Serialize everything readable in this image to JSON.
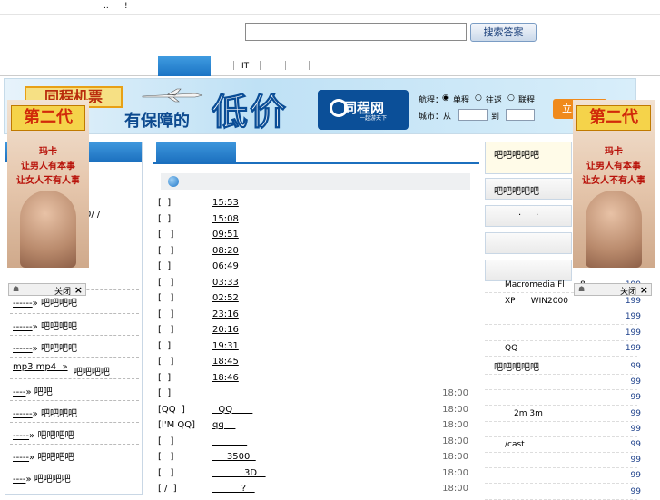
{
  "topbar": {
    "sep": "..",
    "mark": "!"
  },
  "search": {
    "placeholder": "",
    "button": "搜索答案"
  },
  "nav": {
    "tab_it": "IT"
  },
  "banner": {
    "brand": "同程机票",
    "slogan": "有保障的",
    "big": "低价",
    "logo": "同程网",
    "logo_sub": "一起游天下",
    "route_label": "航程：",
    "opt_single": "单程",
    "opt_round": "往返",
    "opt_multi": "联程",
    "city_label": "城市：从",
    "to_label": "到",
    "go": "立即"
  },
  "float_ad": {
    "title": "第二代",
    "sub1": "玛卡",
    "sub2": "让男人有本事",
    "sub3": "让女人不有人事",
    "close": "关闭",
    "x": "×"
  },
  "left": {
    "items": [
      {
        "dash": "‐‐‐‐‐‐‐",
        "text": "",
        "suffix": ""
      },
      {
        "dash": "",
        "text": "0/ /  ",
        "suffix": ""
      },
      {
        "dash": "‐‐‐‐‐‐",
        "text": "»",
        "suffix": "吧吧吧吧"
      },
      {
        "dash": "‐‐‐‐‐‐",
        "text": "»",
        "suffix": "吧吧吧吧"
      },
      {
        "dash": "‐‐‐‐‐‐",
        "text": "»",
        "suffix": "吧吧吧吧"
      },
      {
        "dash": "",
        "text": "mp3 mp4  »",
        "suffix": "吧吧吧吧"
      },
      {
        "dash": "‐‐‐‐",
        "text": "»",
        "suffix": "吧吧"
      },
      {
        "dash": "‐‐‐‐‐‐",
        "text": "»",
        "suffix": "吧吧吧吧"
      },
      {
        "dash": "‐‐‐‐‐",
        "text": "»",
        "suffix": "吧吧吧吧"
      },
      {
        "dash": "‐‐‐‐‐",
        "text": "»",
        "suffix": "吧吧吧吧"
      },
      {
        "dash": "‐‐‐‐",
        "text": "»",
        "suffix": "吧吧吧吧"
      }
    ]
  },
  "center": {
    "rows": [
      {
        "br": "[  ]",
        "tm": "15:53",
        "rt": ""
      },
      {
        "br": "[  ]",
        "tm": "15:08",
        "rt": ""
      },
      {
        "br": "[   ]",
        "tm": "09:51",
        "rt": ""
      },
      {
        "br": "[   ]",
        "tm": "08:20",
        "rt": ""
      },
      {
        "br": "[  ]",
        "tm": "06:49",
        "rt": ""
      },
      {
        "br": "[   ]",
        "tm": "03:33",
        "rt": ""
      },
      {
        "br": "[   ]",
        "tm": "02:52",
        "rt": ""
      },
      {
        "br": "[   ]",
        "tm": "23:16",
        "rt": ""
      },
      {
        "br": "[   ]",
        "tm": "20:16",
        "rt": ""
      },
      {
        "br": "[  ]",
        "tm": "19:31",
        "rt": ""
      },
      {
        "br": "[   ]",
        "tm": "18:45",
        "rt": ""
      },
      {
        "br": "[  ]",
        "tm": "18:46",
        "rt": ""
      },
      {
        "br": "[  ]",
        "tm": "              ",
        "rt": "18:00"
      },
      {
        "br": "[QQ  ]",
        "tm": "  QQ       ",
        "rt": "18:00"
      },
      {
        "br": "[I'M QQ]",
        "tm": "qq    ",
        "rt": "18:00"
      },
      {
        "br": "[   ]",
        "tm": "            ",
        "rt": "18:00"
      },
      {
        "br": "[   ]",
        "tm": "     3500  ",
        "rt": "18:00"
      },
      {
        "br": "[   ]",
        "tm": "           3D   ",
        "rt": "18:00"
      },
      {
        "br": "[ /  ]",
        "tm": "          ?   ",
        "rt": "18:00"
      }
    ]
  },
  "right": {
    "box1": "吧吧吧吧吧",
    "box2": "吧吧吧吧吧",
    "box3": "·     ·",
    "box6": "吧吧吧吧吧",
    "rows": [
      {
        "t": "Macromedia Fl      8",
        "n": "199"
      },
      {
        "t": "XP      WIN2000",
        "n": "199"
      },
      {
        "t": "",
        "n": "199"
      },
      {
        "t": "",
        "n": "199"
      },
      {
        "t": "QQ",
        "n": "199"
      },
      {
        "t": "",
        "n": "99"
      },
      {
        "t": "",
        "n": "99"
      },
      {
        "t": "",
        "n": "99"
      },
      {
        "t": "2m 3m",
        "n": "99"
      },
      {
        "t": "",
        "n": "99"
      },
      {
        "t": "/cast",
        "n": "99"
      },
      {
        "t": "",
        "n": "99"
      },
      {
        "t": "",
        "n": "99"
      },
      {
        "t": "",
        "n": "99"
      }
    ]
  }
}
